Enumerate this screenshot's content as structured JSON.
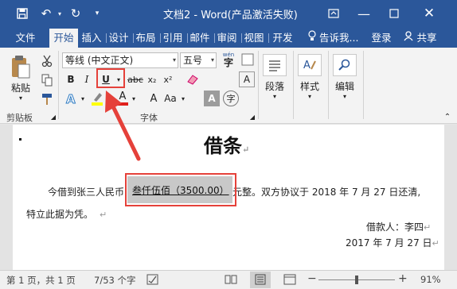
{
  "titlebar": {
    "title": "文档2 - Word(产品激活失败)"
  },
  "tabs": [
    "文件",
    "开始",
    "插入",
    "设计",
    "布局",
    "引用",
    "邮件",
    "审阅",
    "视图",
    "开发"
  ],
  "tell_me": "告诉我...",
  "login": "登录",
  "share": "共享",
  "ribbon": {
    "paste_label": "粘贴",
    "clipboard_label": "剪贴板",
    "font_name": "等线 (中文正文)",
    "font_size": "五号",
    "wen_glyph": "wén",
    "font_group_label": "字体",
    "paragraph_label": "段落",
    "styles_label": "样式",
    "editing_label": "编辑",
    "bold": "B",
    "italic": "I",
    "underline": "U",
    "strike": "abc",
    "subscript": "x₂",
    "superscript": "x²",
    "font_color_letter": "A",
    "char_border": "A",
    "aa_upper": "A",
    "aa_case": "Aa",
    "char_shading": "A",
    "enclose": "字"
  },
  "document": {
    "title": "借条",
    "para1_prefix": "今借到张三人民币",
    "amount": "叁仟伍佰（3500.00）",
    "para1_suffix": "元整。双方协议于 2018 年 7 月 27 日还清,",
    "para2": "特立此据为凭。",
    "borrower": "借款人：李四",
    "date": "2017 年 7 月 27 日"
  },
  "statusbar": {
    "page": "第 1 页，共 1 页",
    "words": "7/53 个字",
    "zoom": "91%"
  },
  "colors": {
    "accent": "#2b579a",
    "highlight": "#e5413a"
  }
}
